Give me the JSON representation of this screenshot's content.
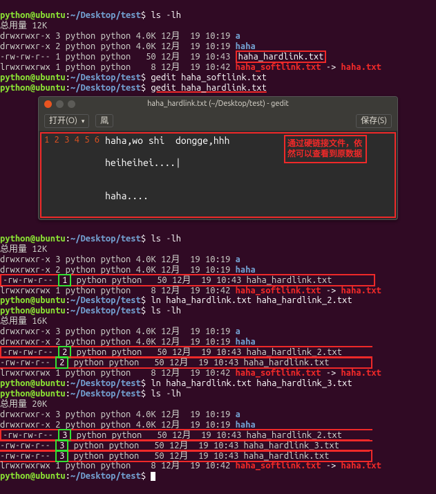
{
  "prompt": {
    "user": "python@ubuntu",
    "path": "~/Desktop/test",
    "sym": "$"
  },
  "total": {
    "t12": "总用量 12K",
    "t16": "总用量 16K",
    "t20": "总用量 20K"
  },
  "sec1": {
    "cmd": "ls -lh",
    "rows": [
      {
        "perm": "drwxrwxr-x",
        "n": "3",
        "own": "python python",
        "size": "4.0K",
        "date": "12月  19 10:19",
        "name": "a",
        "kind": "dir"
      },
      {
        "perm": "drwxrwxr-x",
        "n": "2",
        "own": "python python",
        "size": "4.0K",
        "date": "12月  19 10:19",
        "name": "haha",
        "kind": "dir"
      },
      {
        "perm": "-rw-rw-r--",
        "n": "1",
        "own": "python python",
        "size": "50",
        "date": "12月  19 10:43",
        "name": "haha_hardlink.txt",
        "kind": "file",
        "mark": "red"
      },
      {
        "perm": "lrwxrwxrwx",
        "n": "1",
        "own": "python python",
        "size": "8",
        "date": "12月  19 10:42",
        "name": "haha_softlink.txt",
        "target": "haha.txt",
        "kind": "soft"
      }
    ],
    "cmd2": "gedit haha_softlink.txt",
    "cmd3": "gedit haha_hardlink.txt"
  },
  "gedit": {
    "title": "haha_hardlink.txt (~/Desktop/test) - gedit",
    "open": "打开(O)",
    "save": "保存(S)",
    "newdoc": "凮",
    "lines": [
      "haha,wo shi  dongge,hhh",
      "",
      "heiheihei....|",
      "",
      "",
      "haha...."
    ],
    "annotation": "通过硬链接文件，依然可以查看到原数据"
  },
  "sec2": {
    "cmd": "ls -lh",
    "rows": [
      {
        "perm": "drwxrwxr-x",
        "n": "3",
        "own": "python python",
        "size": "4.0K",
        "date": "12月  19 10:19",
        "name": "a",
        "kind": "dir"
      },
      {
        "perm": "drwxrwxr-x",
        "n": "2",
        "own": "python python",
        "size": "4.0K",
        "date": "12月  19 10:19",
        "name": "haha",
        "kind": "dir"
      },
      {
        "perm": "-rw-rw-r--",
        "n": "1",
        "own": "python python",
        "size": "50",
        "date": "12月  19 10:43",
        "name": "haha_hardlink.txt",
        "kind": "file",
        "mark": "green-red"
      },
      {
        "perm": "lrwxrwxrwx",
        "n": "1",
        "own": "python python",
        "size": "8",
        "date": "12月  19 10:42",
        "name": "haha_softlink.txt",
        "target": "haha.txt",
        "kind": "soft"
      }
    ],
    "cmd2": "ln haha_hardlink.txt haha_hardlink_2.txt",
    "cmd3": "ls -lh"
  },
  "sec3": {
    "rows": [
      {
        "perm": "drwxrwxr-x",
        "n": "3",
        "own": "python python",
        "size": "4.0K",
        "date": "12月  19 10:19",
        "name": "a",
        "kind": "dir"
      },
      {
        "perm": "drwxrwxr-x",
        "n": "2",
        "own": "python python",
        "size": "4.0K",
        "date": "12月  19 10:19",
        "name": "haha",
        "kind": "dir"
      },
      {
        "perm": "-rw-rw-r--",
        "n": "2",
        "own": "python python",
        "size": "50",
        "date": "12月  19 10:43",
        "name": "haha_hardlink_2.txt",
        "kind": "file",
        "mark": "green-red"
      },
      {
        "perm": "-rw-rw-r--",
        "n": "2",
        "own": "python python",
        "size": "50",
        "date": "12月  19 10:43",
        "name": "haha_hardlink.txt",
        "kind": "file",
        "mark": "green-red"
      },
      {
        "perm": "lrwxrwxrwx",
        "n": "1",
        "own": "python python",
        "size": "8",
        "date": "12月  19 10:42",
        "name": "haha_softlink.txt",
        "target": "haha.txt",
        "kind": "soft"
      }
    ],
    "cmd2": "ln haha_hardlink.txt haha_hardlink_3.txt",
    "cmd3": "ls -lh"
  },
  "sec4": {
    "rows": [
      {
        "perm": "drwxrwxr-x",
        "n": "3",
        "own": "python python",
        "size": "4.0K",
        "date": "12月  19 10:19",
        "name": "a",
        "kind": "dir"
      },
      {
        "perm": "drwxrwxr-x",
        "n": "2",
        "own": "python python",
        "size": "4.0K",
        "date": "12月  19 10:19",
        "name": "haha",
        "kind": "dir"
      },
      {
        "perm": "-rw-rw-r--",
        "n": "3",
        "own": "python python",
        "size": "50",
        "date": "12月  19 10:43",
        "name": "haha_hardlink_2.txt",
        "kind": "file",
        "mark": "green-red"
      },
      {
        "perm": "-rw-rw-r--",
        "n": "3",
        "own": "python python",
        "size": "50",
        "date": "12月  19 10:43",
        "name": "haha_hardlink_3.txt",
        "kind": "file",
        "mark": "green-red"
      },
      {
        "perm": "-rw-rw-r--",
        "n": "3",
        "own": "python python",
        "size": "50",
        "date": "12月  19 10:43",
        "name": "haha_hardlink.txt",
        "kind": "file",
        "mark": "green-red"
      },
      {
        "perm": "lrwxrwxrwx",
        "n": "1",
        "own": "python python",
        "size": "8",
        "date": "12月  19 10:42",
        "name": "haha_softlink.txt",
        "target": "haha.txt",
        "kind": "soft"
      }
    ]
  }
}
